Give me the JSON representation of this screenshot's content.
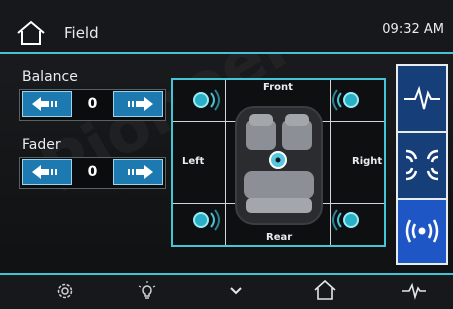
{
  "header": {
    "title": "Field",
    "time": "09:32 AM"
  },
  "balance": {
    "label": "Balance",
    "value": "0"
  },
  "fader": {
    "label": "Fader",
    "value": "0"
  },
  "cabin": {
    "front": "Front",
    "rear": "Rear",
    "left": "Left",
    "right": "Right"
  },
  "tabs": [
    "eq-wave-icon",
    "sound-field-icon",
    "surround-sound-icon"
  ],
  "bottom_nav": [
    "settings-icon",
    "bulb-icon",
    "chevron-down-icon",
    "home-icon",
    "eq-icon"
  ],
  "colors": {
    "accent": "#46c2d6",
    "button": "#1d7ab0",
    "tab": "#163e78",
    "tab_active": "#1f56c5"
  }
}
